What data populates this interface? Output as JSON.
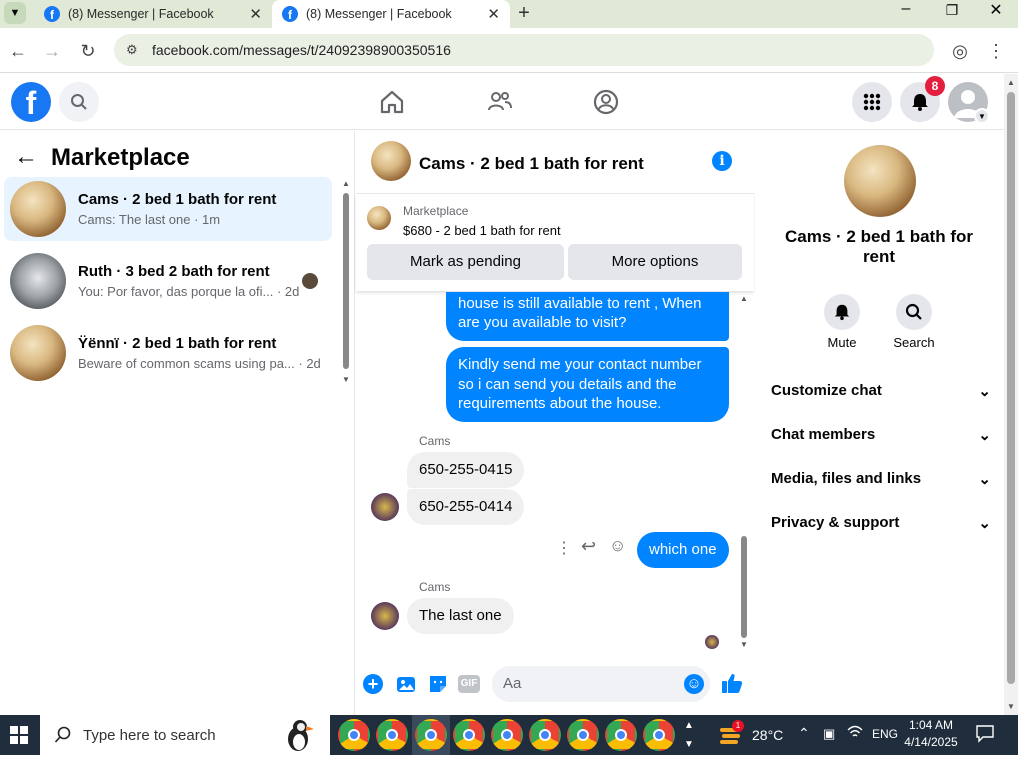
{
  "browser": {
    "tabs": [
      {
        "title": "(8) Messenger | Facebook",
        "active": false
      },
      {
        "title": "(8) Messenger | Facebook",
        "active": true
      }
    ],
    "url": "facebook.com/messages/t/24092398900350516"
  },
  "header": {
    "notification_count": "8"
  },
  "sidebar": {
    "title": "Marketplace",
    "conversations": [
      {
        "name": "Cams · 2 bed 1 bath for rent",
        "preview": "Cams: The last one · 1m",
        "selected": true
      },
      {
        "name": "Ruth · 3 bed 2 bath for rent",
        "preview": "You: Por favor, das porque la ofi... · 2d",
        "selected": false
      },
      {
        "name": "Ÿënnï · 2 bed 1 bath for rent",
        "preview": "Beware of common scams using pa... · 2d",
        "selected": false
      }
    ]
  },
  "chat": {
    "title": "Cams · 2 bed 1 bath for rent",
    "listing_label": "Marketplace",
    "listing_price_title": "$680 - 2 bed 1 bath for rent",
    "mark_pending_label": "Mark as pending",
    "more_options_label": "More options",
    "messages": {
      "out1": "Thanks for your interest, Yes, the house is still available to rent , When are you available to visit?",
      "out2": "Kindly send me your contact number so i can send you details and the requirements about the house.",
      "sender1": "Cams",
      "in1": "650-255-0415",
      "in2": "650-255-0414",
      "out3": "which one",
      "sender2": "Cams",
      "in3": "The last one"
    },
    "composer_placeholder": "Aa",
    "gif_label": "GIF"
  },
  "details": {
    "title": "Cams · 2 bed 1 bath for rent",
    "mute_label": "Mute",
    "search_label": "Search",
    "sections": [
      "Customize chat",
      "Chat members",
      "Media, files and links",
      "Privacy & support"
    ]
  },
  "taskbar": {
    "search_placeholder": "Type here to search",
    "weather": "28°C",
    "language": "ENG",
    "time": "1:04 AM",
    "date": "4/14/2025",
    "weather_badge": "1"
  },
  "colors": {
    "accent": "#0084ff",
    "fb_blue": "#1877f2",
    "badge": "#e41e3f"
  }
}
